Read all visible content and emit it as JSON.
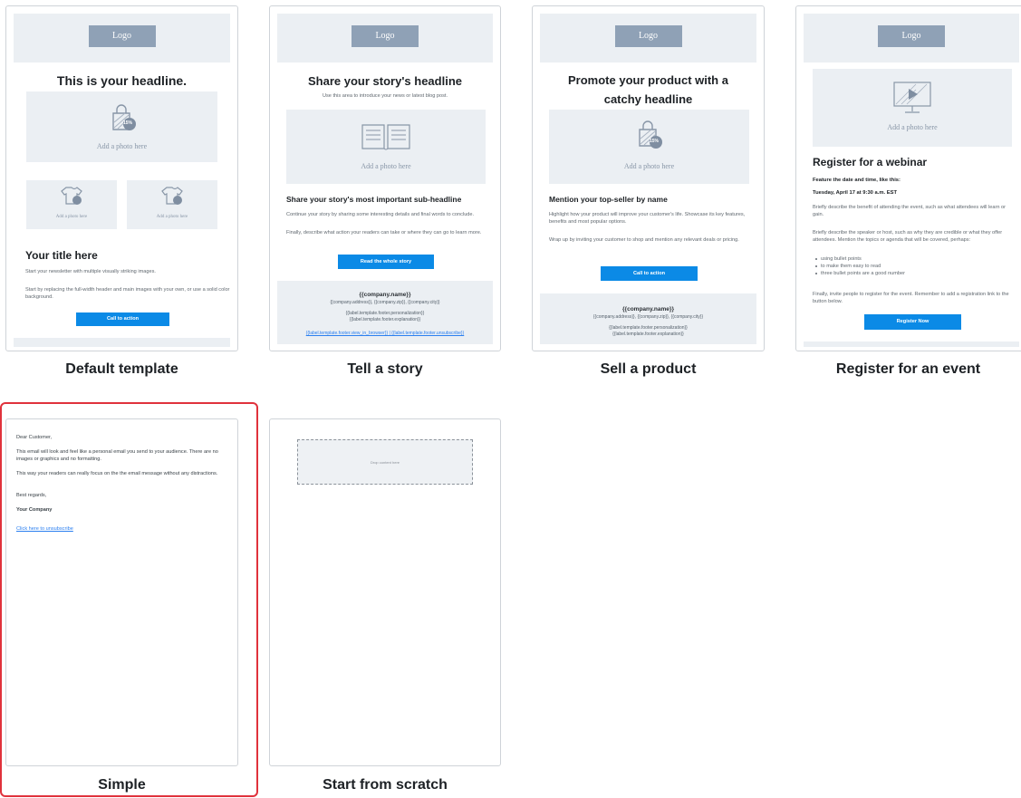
{
  "colors": {
    "accent": "#0b8ae6",
    "selected_ring": "#e0323c",
    "placeholder_bg": "#ebeff3",
    "logo_bg": "#8fa1b6"
  },
  "templates": [
    {
      "title": "Default template",
      "logo": "Logo",
      "headline": "This is your headline.",
      "photo_label": "Add a photo here",
      "badge": "15%",
      "small_photo_label": "Add a photo here",
      "small_badge": "15%",
      "subtitle": "Your title here",
      "para1": "Start your newsletter with multiple visually striking images.",
      "para2": "Start by replacing the full-width header and main images with your own, or use a solid color background.",
      "cta": "Call to action"
    },
    {
      "title": "Tell a story",
      "logo": "Logo",
      "headline": "Share your story's headline",
      "intro": "Use this area to introduce your news or latest blog post.",
      "photo_label": "Add a photo here",
      "subheadline": "Share your story's most important sub-headline",
      "para1": "Continue your story by sharing some interesting details and final words to conclude.",
      "para2": "Finally, describe what action your readers can take or where they can go to learn more.",
      "cta": "Read the whole story",
      "footer_name": "{{company.name}}",
      "footer_address": "{{company.address}}, {{company.zip}}, {{company.city}}",
      "footer_line1": "{{label.template.footer.personalization}}",
      "footer_line2": "{{label.template.footer.explanation}}",
      "footer_links": "{{label.template.footer.view_in_browser}} | {{label.template.footer.unsubscribe}}"
    },
    {
      "title": "Sell a product",
      "logo": "Logo",
      "headline": "Promote your product with a catchy headline",
      "photo_label": "Add a photo here",
      "badge": "15%",
      "subheadline": "Mention your top-seller by name",
      "para1": "Highlight how your product will improve your customer's life. Showcase its key features, benefits and most popular options.",
      "para2": "Wrap up by inviting your customer to shop and mention any relevant deals or pricing.",
      "cta": "Call to action",
      "footer_name": "{{company.name}}",
      "footer_address": "{{company.address}}, {{company.zip}}, {{company.city}}",
      "footer_line1": "{{label.template.footer.personalization}}",
      "footer_line2": "{{label.template.footer.explanation}}"
    },
    {
      "title": "Register for an event",
      "logo": "Logo",
      "photo_label": "Add a photo here",
      "headline": "Register for a webinar",
      "feature": "Feature the date and time, like this:",
      "date": "Tuesday, April 17 at 9:30 a.m. EST",
      "para1": "Briefly describe the benefit of attending the event, such as what attendees will learn or gain.",
      "para2": "Briefly describe the speaker or host, such as why they are credible or what they offer attendees. Mention the topics or agenda that will be covered, perhaps:",
      "bullets": [
        "using bullet points",
        "to make them easy to read",
        "three bullet points are a good number"
      ],
      "para3": "Finally, invite people to register for the event. Remember to add a registration link to the button below.",
      "cta": "Register Now"
    },
    {
      "title": "Simple",
      "greeting": "Dear Customer,",
      "para1": "This email will look and feel like a personal email you send to your audience. There are no images or graphics and no formatting.",
      "para2": "This way your readers can really focus on the the email message without any distractions.",
      "closing": "Best regards,",
      "company": "Your Company",
      "unsubscribe": "Click here to unsubscribe"
    },
    {
      "title": "Start from scratch",
      "dropzone": "Drop content here"
    }
  ]
}
